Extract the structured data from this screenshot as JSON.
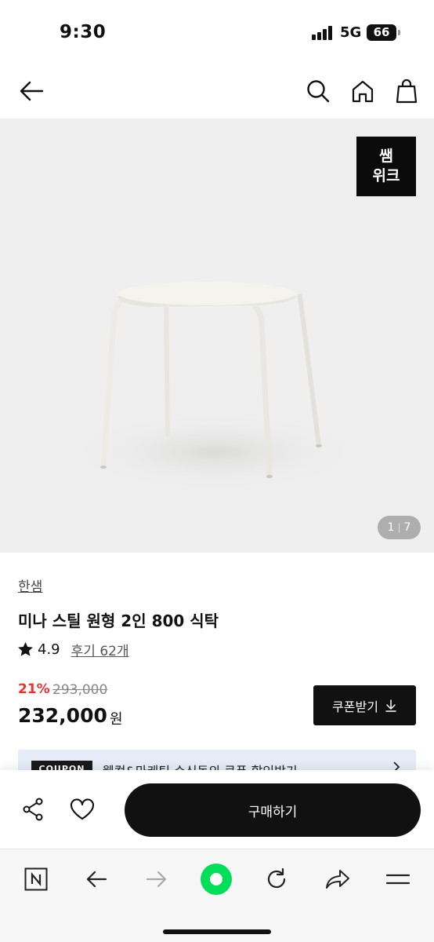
{
  "status_bar": {
    "time": "9:30",
    "network": "5G",
    "battery": "66"
  },
  "header": {
    "back_icon": "arrow-left-icon",
    "search_icon": "search-icon",
    "home_icon": "home-icon",
    "cart_icon": "shopping-bag-icon"
  },
  "gallery": {
    "badge": "쌤\n위크",
    "current": "1",
    "total": "7"
  },
  "product": {
    "brand": "한샘",
    "title": "미나 스틸 원형 2인 800 식탁",
    "rating": "4.9",
    "reviews": "후기 62개",
    "discount": "21%",
    "original_price": "293,000",
    "price": "232,000",
    "price_unit": "원",
    "coupon_button": "쿠폰받기"
  },
  "coupon_banner": {
    "tag": "COUPON",
    "text": "웰컴&마케팅 수신동의 쿠폰 할인받기"
  },
  "buy_bar": {
    "buy_label": "구매하기",
    "share_icon": "share-icon",
    "like_icon": "heart-icon"
  },
  "browser_toolbar": {
    "items": [
      "naver-icon",
      "back-arrow-icon",
      "forward-arrow-icon",
      "green-record-icon",
      "refresh-icon",
      "share-arrow-icon",
      "menu-icon"
    ]
  },
  "colors": {
    "discount": "#e8322f",
    "accent_green": "#00de5a",
    "dark": "#111111",
    "coupon_bg": "#e6edf8"
  }
}
